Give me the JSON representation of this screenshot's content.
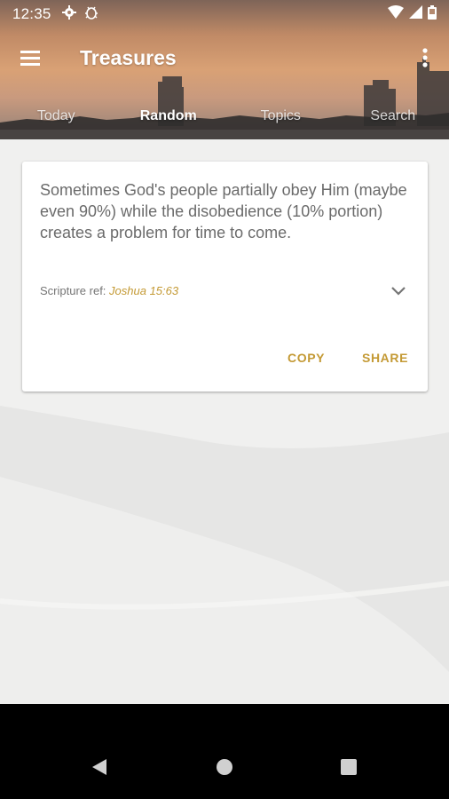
{
  "status_bar": {
    "time": "12:35",
    "icons": [
      "settings-gear-icon",
      "debug-bug-icon",
      "wifi-icon",
      "signal-icon",
      "battery-icon"
    ]
  },
  "toolbar": {
    "title": "Treasures",
    "menu_icon": "hamburger-menu-icon",
    "overflow_icon": "more-vert-icon"
  },
  "tabs": [
    {
      "label": "Today",
      "active": false
    },
    {
      "label": "Random",
      "active": true
    },
    {
      "label": "Topics",
      "active": false
    },
    {
      "label": "Search",
      "active": false
    }
  ],
  "card": {
    "quote": "Sometimes God's people partially obey Him (maybe even 90%) while the disobedience (10% portion) creates a problem for time to come.",
    "scripture_label": "Scripture ref: ",
    "scripture_ref": "Joshua 15:63",
    "copy_label": "COPY",
    "share_label": "SHARE"
  },
  "colors": {
    "accent": "#c49a35",
    "quote_text": "#6b6b6b"
  },
  "nav_bar": {
    "buttons": [
      "back-icon",
      "home-icon",
      "recents-icon"
    ]
  }
}
